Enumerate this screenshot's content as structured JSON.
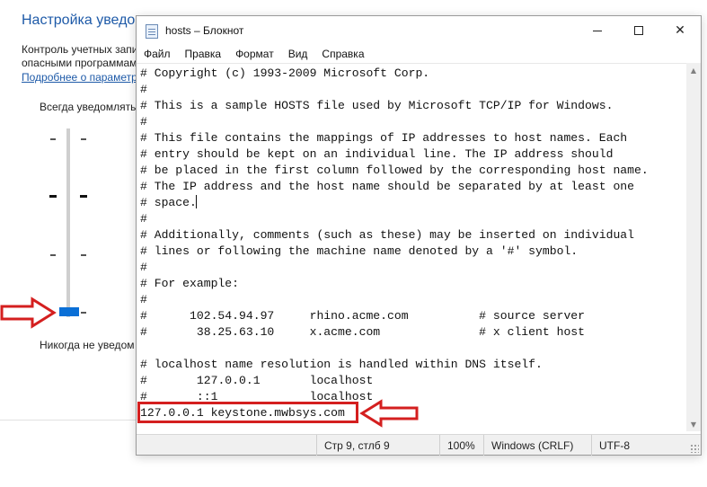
{
  "background_window": {
    "title": "Настройка уведомл",
    "description_lines": [
      "Контроль учетных запи",
      "опасными программам"
    ],
    "link": "Подробнее о параметр",
    "slider_top_label": "Всегда уведомлять",
    "slider_bottom_label": "Никогда не уведом",
    "slider_level_index": 0,
    "slider_levels": 4,
    "accent_color": "#0a6fd6"
  },
  "notepad": {
    "title": "hosts – Блокнот",
    "icon": "notepad-icon",
    "window_buttons": {
      "minimize": "minimize-icon",
      "maximize": "maximize-icon",
      "close": "✕"
    },
    "menu": [
      "Файл",
      "Правка",
      "Формат",
      "Вид",
      "Справка"
    ],
    "lines": [
      "# Copyright (c) 1993-2009 Microsoft Corp.",
      "#",
      "# This is a sample HOSTS file used by Microsoft TCP/IP for Windows.",
      "#",
      "# This file contains the mappings of IP addresses to host names. Each",
      "# entry should be kept on an individual line. The IP address should",
      "# be placed in the first column followed by the corresponding host name.",
      "# The IP address and the host name should be separated by at least one",
      "# space.",
      "#",
      "# Additionally, comments (such as these) may be inserted on individual",
      "# lines or following the machine name denoted by a '#' symbol.",
      "#",
      "# For example:",
      "#",
      "#      102.54.94.97     rhino.acme.com          # source server",
      "#       38.25.63.10     x.acme.com              # x client host",
      "",
      "# localhost name resolution is handled within DNS itself.",
      "#\t127.0.0.1       localhost",
      "#\t::1             localhost",
      "127.0.0.1 keystone.mwbsys.com"
    ],
    "status": {
      "position": "Стр 9, стлб 9",
      "zoom": "100%",
      "line_endings": "Windows (CRLF)",
      "encoding": "UTF-8"
    }
  },
  "annotations": {
    "color": "#d41f1f",
    "highlighted_line": "127.0.0.1 keystone.mwbsys.com"
  }
}
